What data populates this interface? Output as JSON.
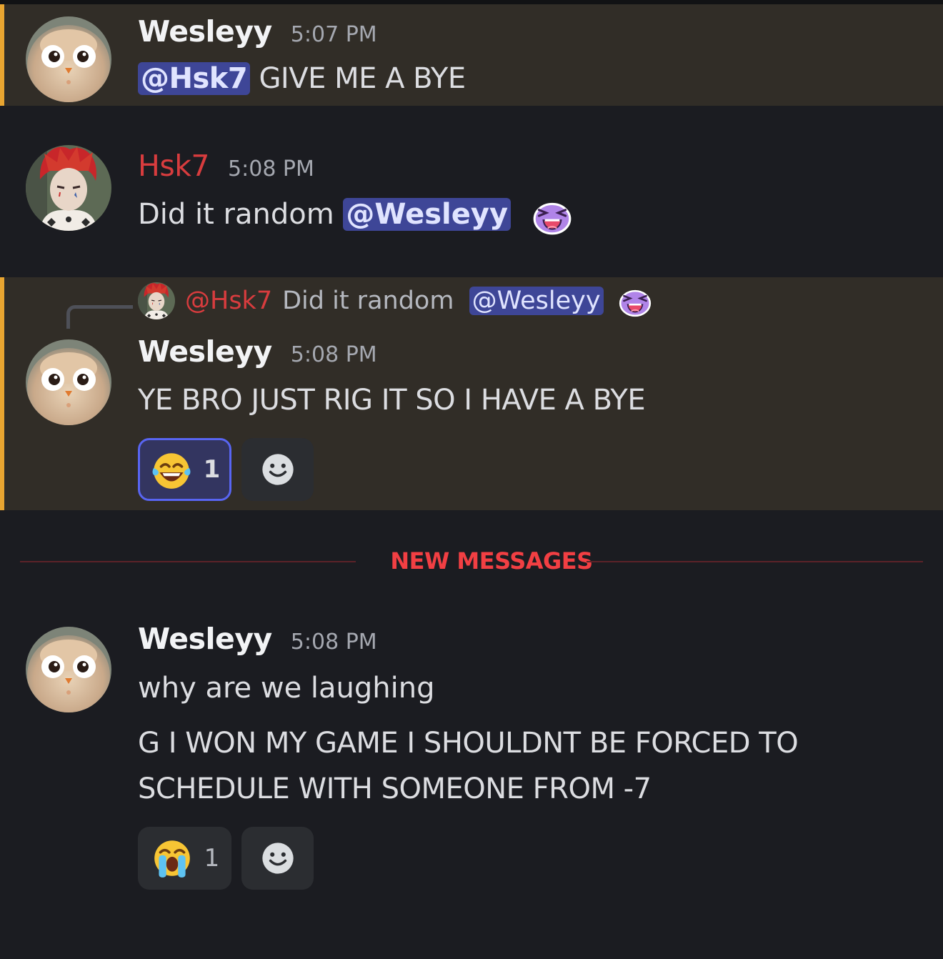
{
  "divider": {
    "label": "NEW MESSAGES"
  },
  "messages": [
    {
      "author": "Wesleyy",
      "time": "5:07 PM",
      "mention": "@Hsk7",
      "text": "GIVE ME A BYE"
    },
    {
      "author": "Hsk7",
      "time": "5:08 PM",
      "text": "Did it random",
      "mention": "@Wesleyy",
      "emoji": "purple-laughing-creature-emoji"
    },
    {
      "reply": {
        "author": "@Hsk7",
        "text": "Did it random",
        "mention": "@Wesleyy",
        "emoji": "purple-laughing-creature-emoji"
      },
      "author": "Wesleyy",
      "time": "5:08 PM",
      "text": "YE BRO JUST RIG IT SO I HAVE A BYE",
      "reaction": {
        "emoji": "joy-emoji",
        "count": "1"
      }
    },
    {
      "author": "Wesleyy",
      "time": "5:08 PM",
      "line1": "why are we laughing",
      "line2": "G I WON MY GAME I SHOULDNT BE FORCED TO",
      "line3": "SCHEDULE WITH SOMEONE FROM -7",
      "reaction": {
        "emoji": "sob-emoji",
        "count": "1"
      }
    }
  ],
  "colors": {
    "background": "#1b1c21",
    "mention_highlight": "#312d27",
    "mention_bar": "#e8a531",
    "mention_chip": "#3e4697",
    "new_messages": "#f23f43",
    "hsk7_name": "#d83c3e"
  }
}
